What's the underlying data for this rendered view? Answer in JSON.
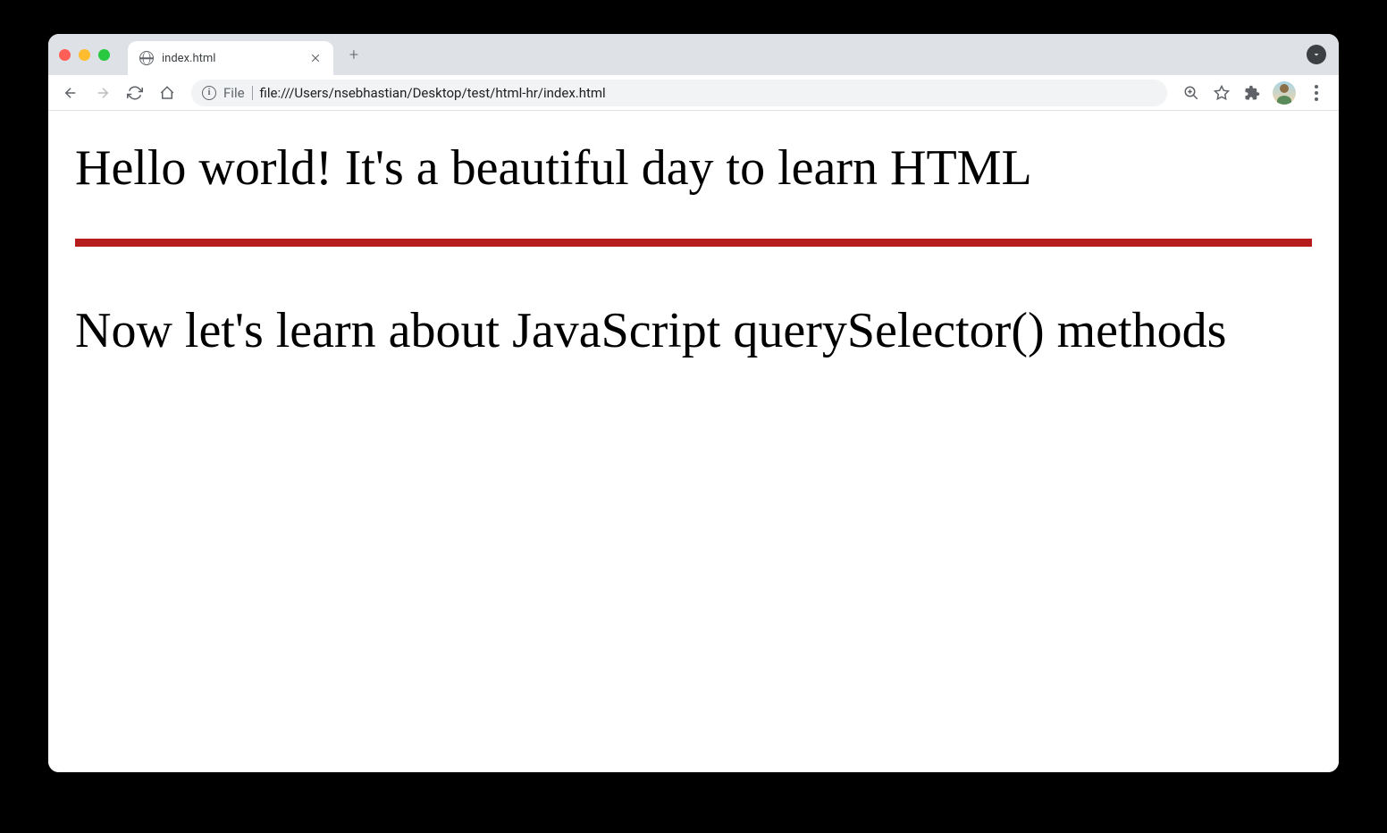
{
  "tab": {
    "title": "index.html"
  },
  "address_bar": {
    "file_label": "File",
    "url": "file:///Users/nsebhastian/Desktop/test/html-hr/index.html"
  },
  "content": {
    "heading1": "Hello world! It's a beautiful day to learn HTML",
    "heading2": "Now let's learn about JavaScript querySelector() methods",
    "hr_color": "#b71c1c"
  }
}
